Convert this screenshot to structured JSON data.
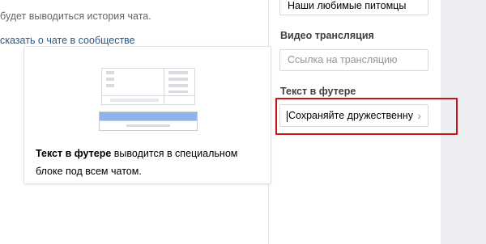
{
  "chat_info": {
    "history_text": "будет выводиться история чата.",
    "community_link": "сказать о чате в сообществе"
  },
  "fields": {
    "chat_title_value": "Наши любимые питомцы",
    "video": {
      "label": "Видео трансляция",
      "placeholder": "Ссылка на трансляцию"
    },
    "footer": {
      "label": "Текст в футере",
      "value": "Сохраняйте дружественну"
    }
  },
  "tooltip": {
    "bold": "Текст в футере",
    "rest": " выводится в специальном блоке под всем чатом."
  },
  "colors": {
    "highlight": "#d11111",
    "accent_bar": "#8fb4ec",
    "link": "#2a5885"
  },
  "icons": {
    "chevron": "chevron-right-icon"
  }
}
